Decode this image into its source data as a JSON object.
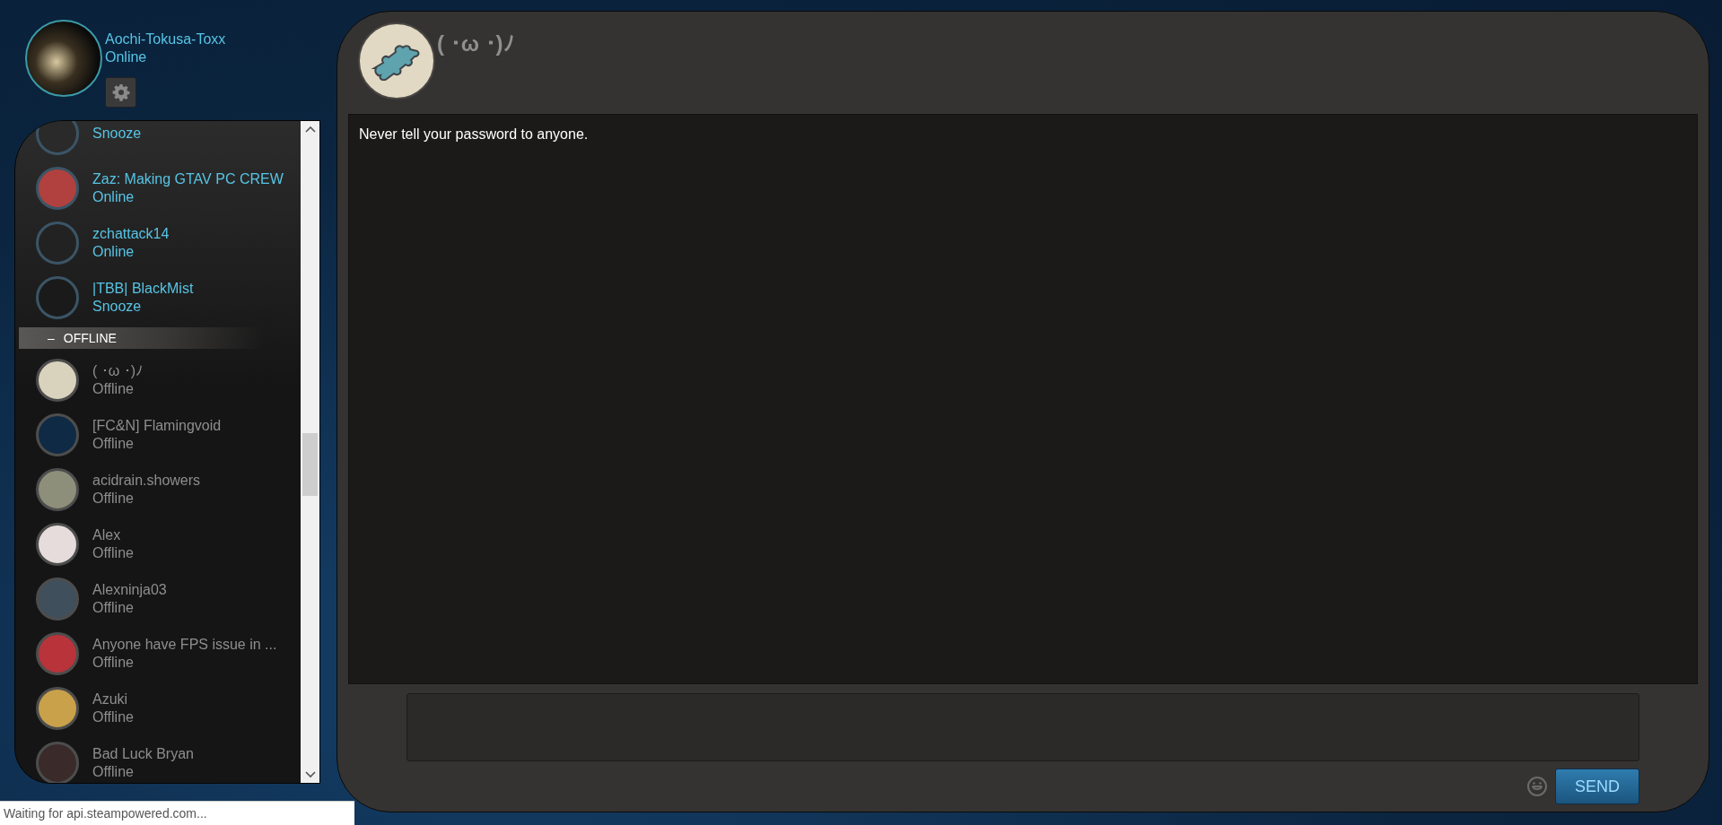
{
  "profile": {
    "name": "Aochi-Tokusa-Toxx",
    "status": "Online"
  },
  "friends": [
    {
      "status": "Snooze",
      "kind": "online"
    },
    {
      "name": "Zaz: Making GTAV PC CREW",
      "status": "Online",
      "kind": "online"
    },
    {
      "name": "zchattack14",
      "status": "Online",
      "kind": "online"
    },
    {
      "name": "|TBB| BlackMist",
      "status": "Snooze",
      "kind": "online"
    }
  ],
  "offline_group": {
    "toggle": "–",
    "label": "OFFLINE",
    "friends": [
      {
        "name": "( ･ω ･)ﾉ",
        "status": "Offline",
        "kind": "offline"
      },
      {
        "name": "[FC&N] Flamingvoid",
        "status": "Offline",
        "kind": "offline"
      },
      {
        "name": "acidrain.showers",
        "status": "Offline",
        "kind": "offline"
      },
      {
        "name": "Alex",
        "status": "Offline",
        "kind": "offline"
      },
      {
        "name": "Alexninja03",
        "status": "Offline",
        "kind": "offline"
      },
      {
        "name": "Anyone have FPS issue in ...",
        "status": "Offline",
        "kind": "offline"
      },
      {
        "name": "Azuki",
        "status": "Offline",
        "kind": "offline"
      },
      {
        "name": "Bad Luck Bryan",
        "status": "Offline",
        "kind": "offline"
      }
    ]
  },
  "chat": {
    "title": "( ･ω ･)ﾉ",
    "messages": [
      "Never tell your password to anyone."
    ],
    "send": "SEND"
  },
  "status_bar": "Waiting for api.steampowered.com..."
}
